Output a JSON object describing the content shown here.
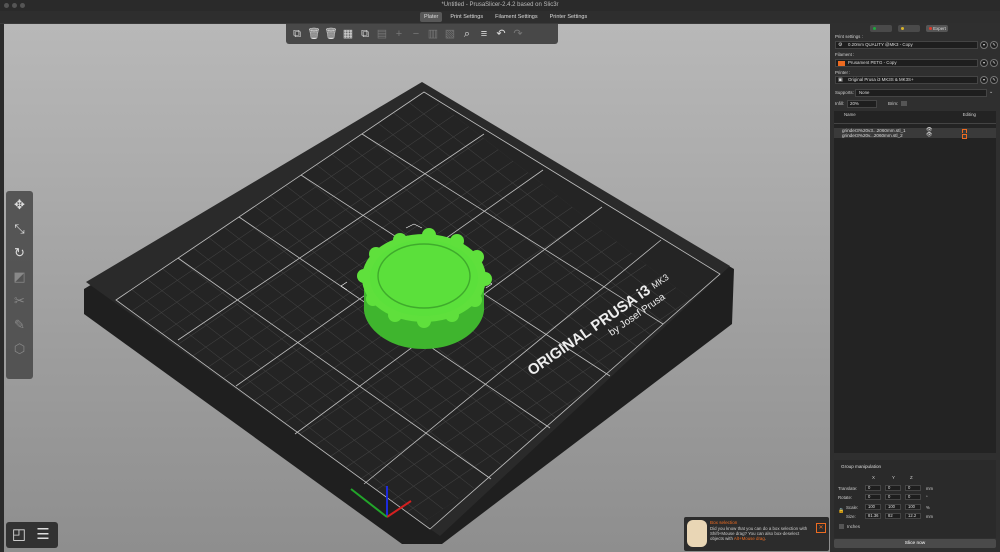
{
  "window": {
    "title": "*Untitled - PrusaSlicer-2.4.2 based on Slic3r"
  },
  "tabs": [
    {
      "label": "Plater",
      "active": true
    },
    {
      "label": "Print Settings",
      "active": false
    },
    {
      "label": "Filament Settings",
      "active": false
    },
    {
      "label": "Printer Settings",
      "active": false
    }
  ],
  "top_toolbar": {
    "icons": [
      "add-object-icon",
      "delete-icon",
      "delete-all-icon",
      "arrange-icon",
      "copy-icon",
      "paste-icon",
      "add-instance-icon",
      "remove-instance-icon",
      "split-objects-icon",
      "split-parts-icon",
      "search-icon",
      "layers-editing-icon",
      "undo-icon",
      "redo-icon"
    ]
  },
  "left_toolbar": {
    "icons": [
      "move-icon",
      "scale-icon",
      "rotate-icon",
      "place-on-face-icon",
      "cut-icon",
      "paint-supports-icon",
      "seam-painting-icon"
    ]
  },
  "bed": {
    "label_line1": "ORIGINAL PRUSA i3",
    "label_mk": "MK3",
    "label_line2": "by Josef Prusa"
  },
  "hint": {
    "title": "Box selection",
    "text_before": "Did you know that you can do a box selection with Shift+Mouse drag? You can also box-deselect objects with ",
    "text_link": "Alt+Mouse drag",
    "text_after": "."
  },
  "sidebar": {
    "mode_buttons": [
      {
        "label": "",
        "color": "#1fa83f"
      },
      {
        "label": "",
        "color": "#d8b32a"
      },
      {
        "label": "Expert",
        "color": "#e03b2b"
      }
    ],
    "print_settings_label": "Print settings :",
    "print_settings_value": "0.20mm QUALITY @MK3 - Copy",
    "filament_label": "Filament :",
    "filament_value": "Prusament PETG - Copy",
    "filament_color": "#ed6b21",
    "printer_label": "Printer :",
    "printer_value": "Original Prusa i3 MK3S & MK3S+",
    "supports_label": "Supports:",
    "supports_value": "None",
    "infill_label": "Infill:",
    "infill_value": "20%",
    "brim_label": "Brim:",
    "objects_header_name": "Name",
    "objects_header_editing": "Editing",
    "objects": [
      {
        "name": "grinder3%20v3...2060mm.stl_1"
      },
      {
        "name": "grinder3%20v...2060mm.stl_2"
      }
    ],
    "manipulation": {
      "title": "Group manipulation",
      "axes": [
        "X",
        "Y",
        "Z"
      ],
      "rows": [
        {
          "label": "Translate:",
          "values": [
            "0",
            "0",
            "0"
          ],
          "unit": "mm"
        },
        {
          "label": "Rotate:",
          "values": [
            "0",
            "0",
            "0"
          ],
          "unit": "°"
        },
        {
          "label": "Scale:",
          "values": [
            "100",
            "100",
            "100"
          ],
          "unit": "%"
        },
        {
          "label": "Size:",
          "values": [
            "81.36",
            "82",
            "12.2"
          ],
          "unit": "mm"
        }
      ],
      "inches_label": "Inches"
    },
    "slice_button": "Slice now"
  }
}
